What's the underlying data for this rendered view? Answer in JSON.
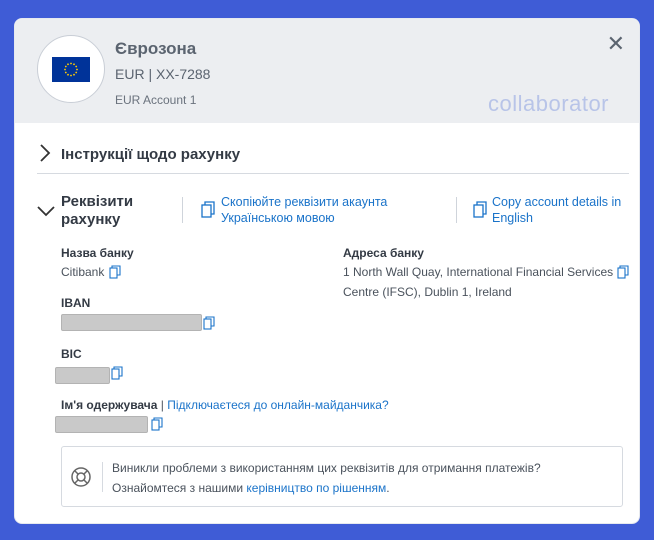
{
  "header": {
    "title": "Єврозона",
    "subtitle": "EUR | XX-7288",
    "account_name": "EUR Account 1",
    "watermark": "collaborator",
    "close_icon": "close-icon",
    "flag": "eu-flag"
  },
  "sections": {
    "instructions_label": "Інструкції щодо рахунку",
    "details_label": "Реквізити рахунку"
  },
  "copy_actions": {
    "ukrainian": "Скопіюйте реквізити акаунта Українською мовою",
    "english": "Copy account details in English"
  },
  "fields": {
    "bank_name_label": "Назва банку",
    "bank_name_value": "Citibank",
    "bank_address_label": "Адреса банку",
    "bank_address_value": "1 North Wall Quay, International Financial Services Centre (IFSC), Dublin 1, Ireland",
    "iban_label": "IBAN",
    "bic_label": "BIC",
    "beneficiary_label": "Ім'я одержувача",
    "beneficiary_separator": "|",
    "beneficiary_link": "Підключаєтеся до онлайн-майданчика?"
  },
  "help": {
    "line1": "Виникли проблеми з використанням цих реквізитів для отримання платежів?",
    "line2_prefix": "Ознайомтеся з нашими ",
    "line2_link": "керівництво по рішенням",
    "line2_suffix": "."
  },
  "colors": {
    "background": "#3f5cd6",
    "header_bg": "#eceef1",
    "link": "#1a73c9",
    "flag_blue": "#003399",
    "flag_star": "#ffcc00"
  }
}
